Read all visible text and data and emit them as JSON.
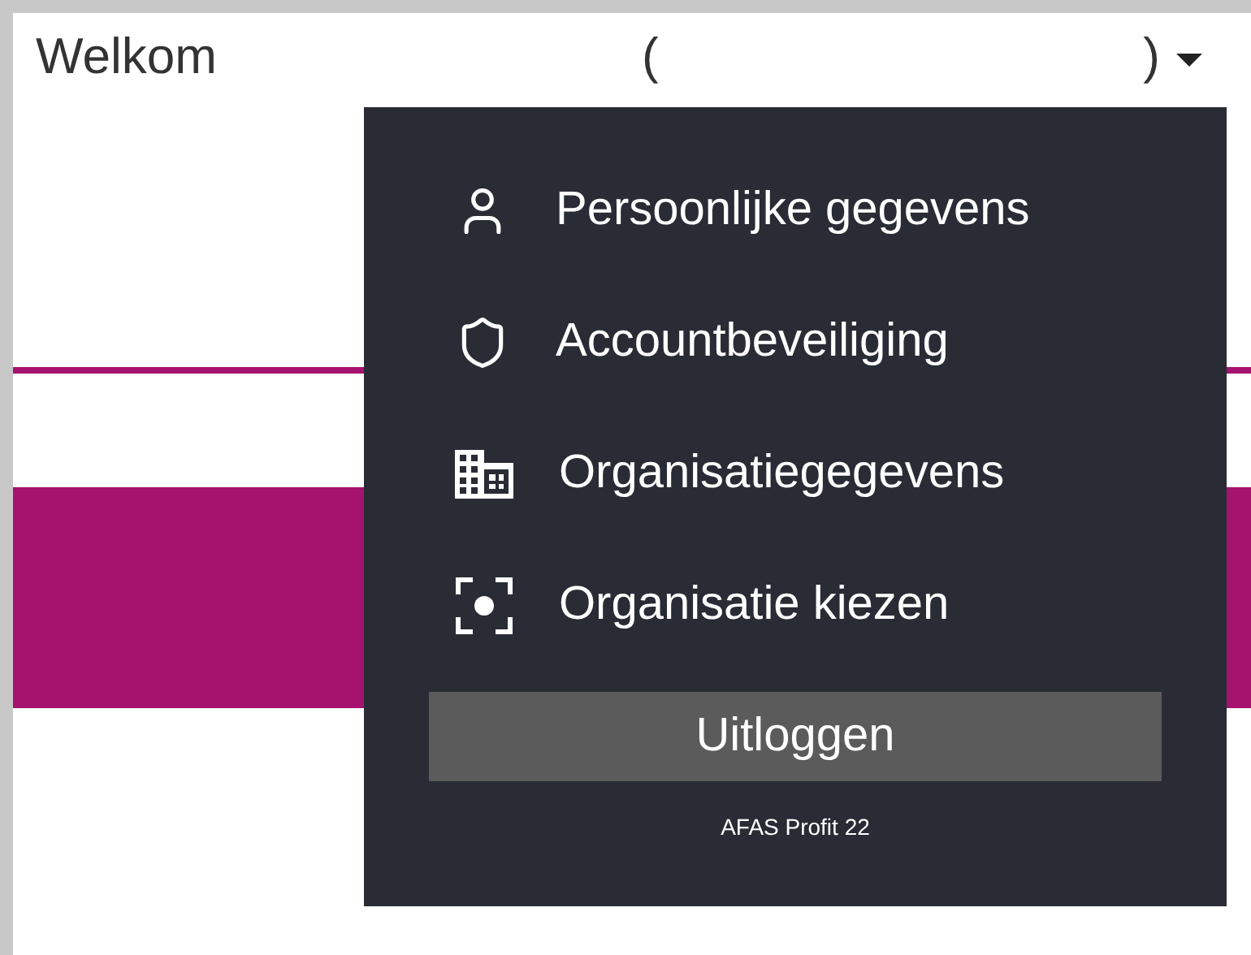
{
  "header": {
    "greeting": "Welkom",
    "user_open": "(",
    "user_close": ")"
  },
  "menu": {
    "items": [
      {
        "label": "Persoonlijke gegevens"
      },
      {
        "label": "Accountbeveiliging"
      },
      {
        "label": "Organisatiegegevens"
      },
      {
        "label": "Organisatie kiezen"
      }
    ],
    "logout": "Uitloggen",
    "version": "AFAS Profit 22"
  }
}
